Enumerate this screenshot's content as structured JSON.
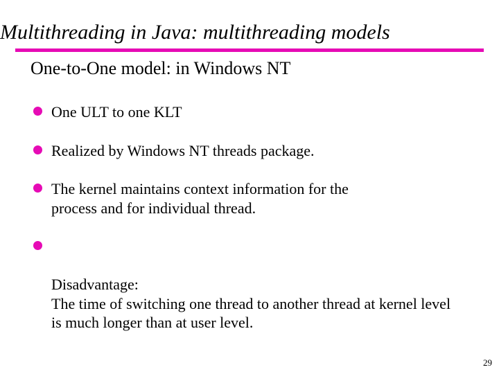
{
  "title": "Multithreading in Java: multithreading models",
  "subtitle": "One-to-One model:  in Windows NT",
  "bullets": [
    "One ULT to one KLT",
    "Realized by Windows NT threads package.",
    "The kernel maintains context information for the process and for individual thread.",
    "Disadvantage:\nThe time of switching one thread to another thread at kernel level is much longer than at user level."
  ],
  "page_number": "29"
}
